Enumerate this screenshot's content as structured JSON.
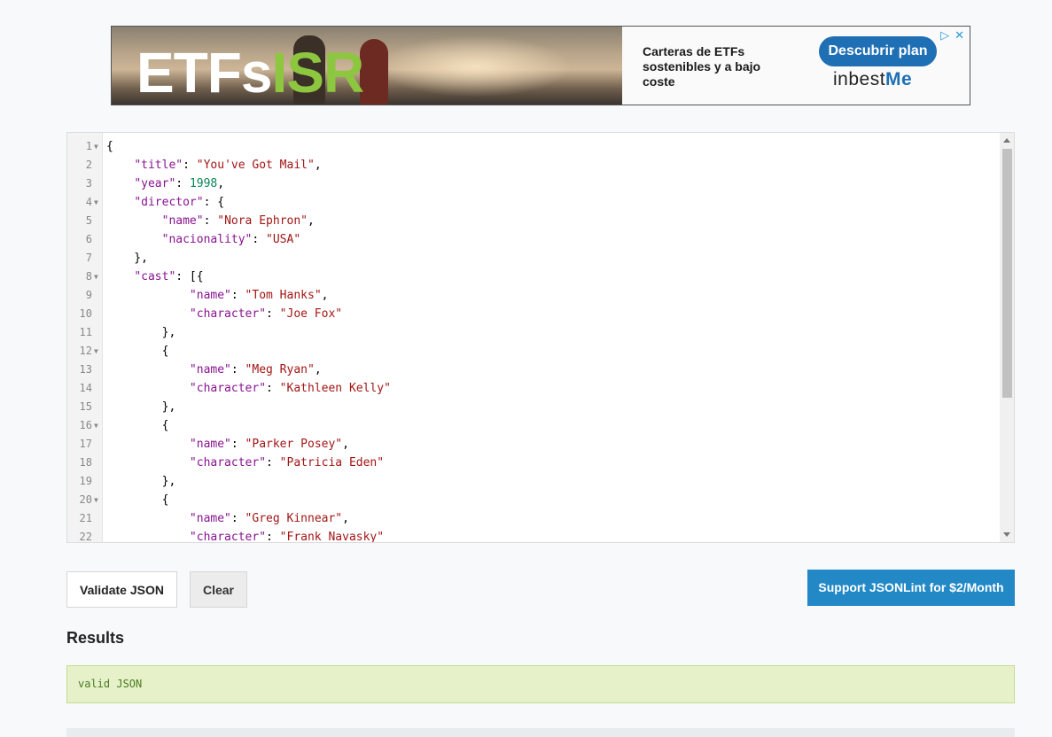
{
  "ad": {
    "logo_part1": "ETFs",
    "logo_part2": "ISR",
    "headline": "Carteras de ETFs sostenibles y a bajo coste",
    "cta": "Descubrir plan",
    "brand_a": "inbest",
    "brand_b": "Me"
  },
  "editor": {
    "lines": [
      {
        "n": "1",
        "fold": true
      },
      {
        "n": "2",
        "fold": false
      },
      {
        "n": "3",
        "fold": false
      },
      {
        "n": "4",
        "fold": true
      },
      {
        "n": "5",
        "fold": false
      },
      {
        "n": "6",
        "fold": false
      },
      {
        "n": "7",
        "fold": false
      },
      {
        "n": "8",
        "fold": true
      },
      {
        "n": "9",
        "fold": false
      },
      {
        "n": "10",
        "fold": false
      },
      {
        "n": "11",
        "fold": false
      },
      {
        "n": "12",
        "fold": true
      },
      {
        "n": "13",
        "fold": false
      },
      {
        "n": "14",
        "fold": false
      },
      {
        "n": "15",
        "fold": false
      },
      {
        "n": "16",
        "fold": true
      },
      {
        "n": "17",
        "fold": false
      },
      {
        "n": "18",
        "fold": false
      },
      {
        "n": "19",
        "fold": false
      },
      {
        "n": "20",
        "fold": true
      },
      {
        "n": "21",
        "fold": false
      },
      {
        "n": "22",
        "fold": false
      }
    ],
    "code": [
      [
        {
          "t": "p",
          "v": "{"
        }
      ],
      [
        {
          "t": "p",
          "v": "    "
        },
        {
          "t": "k",
          "v": "\"title\""
        },
        {
          "t": "p",
          "v": ": "
        },
        {
          "t": "s",
          "v": "\"You've Got Mail\""
        },
        {
          "t": "p",
          "v": ","
        }
      ],
      [
        {
          "t": "p",
          "v": "    "
        },
        {
          "t": "k",
          "v": "\"year\""
        },
        {
          "t": "p",
          "v": ": "
        },
        {
          "t": "n",
          "v": "1998"
        },
        {
          "t": "p",
          "v": ","
        }
      ],
      [
        {
          "t": "p",
          "v": "    "
        },
        {
          "t": "k",
          "v": "\"director\""
        },
        {
          "t": "p",
          "v": ": {"
        }
      ],
      [
        {
          "t": "p",
          "v": "        "
        },
        {
          "t": "k",
          "v": "\"name\""
        },
        {
          "t": "p",
          "v": ": "
        },
        {
          "t": "s",
          "v": "\"Nora Ephron\""
        },
        {
          "t": "p",
          "v": ","
        }
      ],
      [
        {
          "t": "p",
          "v": "        "
        },
        {
          "t": "k",
          "v": "\"nacionality\""
        },
        {
          "t": "p",
          "v": ": "
        },
        {
          "t": "s",
          "v": "\"USA\""
        }
      ],
      [
        {
          "t": "p",
          "v": "    },"
        }
      ],
      [
        {
          "t": "p",
          "v": "    "
        },
        {
          "t": "k",
          "v": "\"cast\""
        },
        {
          "t": "p",
          "v": ": [{"
        }
      ],
      [
        {
          "t": "p",
          "v": "            "
        },
        {
          "t": "k",
          "v": "\"name\""
        },
        {
          "t": "p",
          "v": ": "
        },
        {
          "t": "s",
          "v": "\"Tom Hanks\""
        },
        {
          "t": "p",
          "v": ","
        }
      ],
      [
        {
          "t": "p",
          "v": "            "
        },
        {
          "t": "k",
          "v": "\"character\""
        },
        {
          "t": "p",
          "v": ": "
        },
        {
          "t": "s",
          "v": "\"Joe Fox\""
        }
      ],
      [
        {
          "t": "p",
          "v": "        },"
        }
      ],
      [
        {
          "t": "p",
          "v": "        {"
        }
      ],
      [
        {
          "t": "p",
          "v": "            "
        },
        {
          "t": "k",
          "v": "\"name\""
        },
        {
          "t": "p",
          "v": ": "
        },
        {
          "t": "s",
          "v": "\"Meg Ryan\""
        },
        {
          "t": "p",
          "v": ","
        }
      ],
      [
        {
          "t": "p",
          "v": "            "
        },
        {
          "t": "k",
          "v": "\"character\""
        },
        {
          "t": "p",
          "v": ": "
        },
        {
          "t": "s",
          "v": "\"Kathleen Kelly\""
        }
      ],
      [
        {
          "t": "p",
          "v": "        },"
        }
      ],
      [
        {
          "t": "p",
          "v": "        {"
        }
      ],
      [
        {
          "t": "p",
          "v": "            "
        },
        {
          "t": "k",
          "v": "\"name\""
        },
        {
          "t": "p",
          "v": ": "
        },
        {
          "t": "s",
          "v": "\"Parker Posey\""
        },
        {
          "t": "p",
          "v": ","
        }
      ],
      [
        {
          "t": "p",
          "v": "            "
        },
        {
          "t": "k",
          "v": "\"character\""
        },
        {
          "t": "p",
          "v": ": "
        },
        {
          "t": "s",
          "v": "\"Patricia Eden\""
        }
      ],
      [
        {
          "t": "p",
          "v": "        },"
        }
      ],
      [
        {
          "t": "p",
          "v": "        {"
        }
      ],
      [
        {
          "t": "p",
          "v": "            "
        },
        {
          "t": "k",
          "v": "\"name\""
        },
        {
          "t": "p",
          "v": ": "
        },
        {
          "t": "s",
          "v": "\"Greg Kinnear\""
        },
        {
          "t": "p",
          "v": ","
        }
      ],
      [
        {
          "t": "p",
          "v": "            "
        },
        {
          "t": "k",
          "v": "\"character\""
        },
        {
          "t": "p",
          "v": ": "
        },
        {
          "t": "s",
          "v": "\"Frank Navasky\""
        }
      ]
    ]
  },
  "buttons": {
    "validate": "Validate JSON",
    "clear": "Clear",
    "support": "Support JSONLint for $2/Month"
  },
  "results": {
    "title": "Results",
    "message": "valid JSON"
  },
  "colors": {
    "accent": "#2388c6",
    "valid_bg": "#e6f1c9",
    "valid_text": "#4a7b1f"
  }
}
